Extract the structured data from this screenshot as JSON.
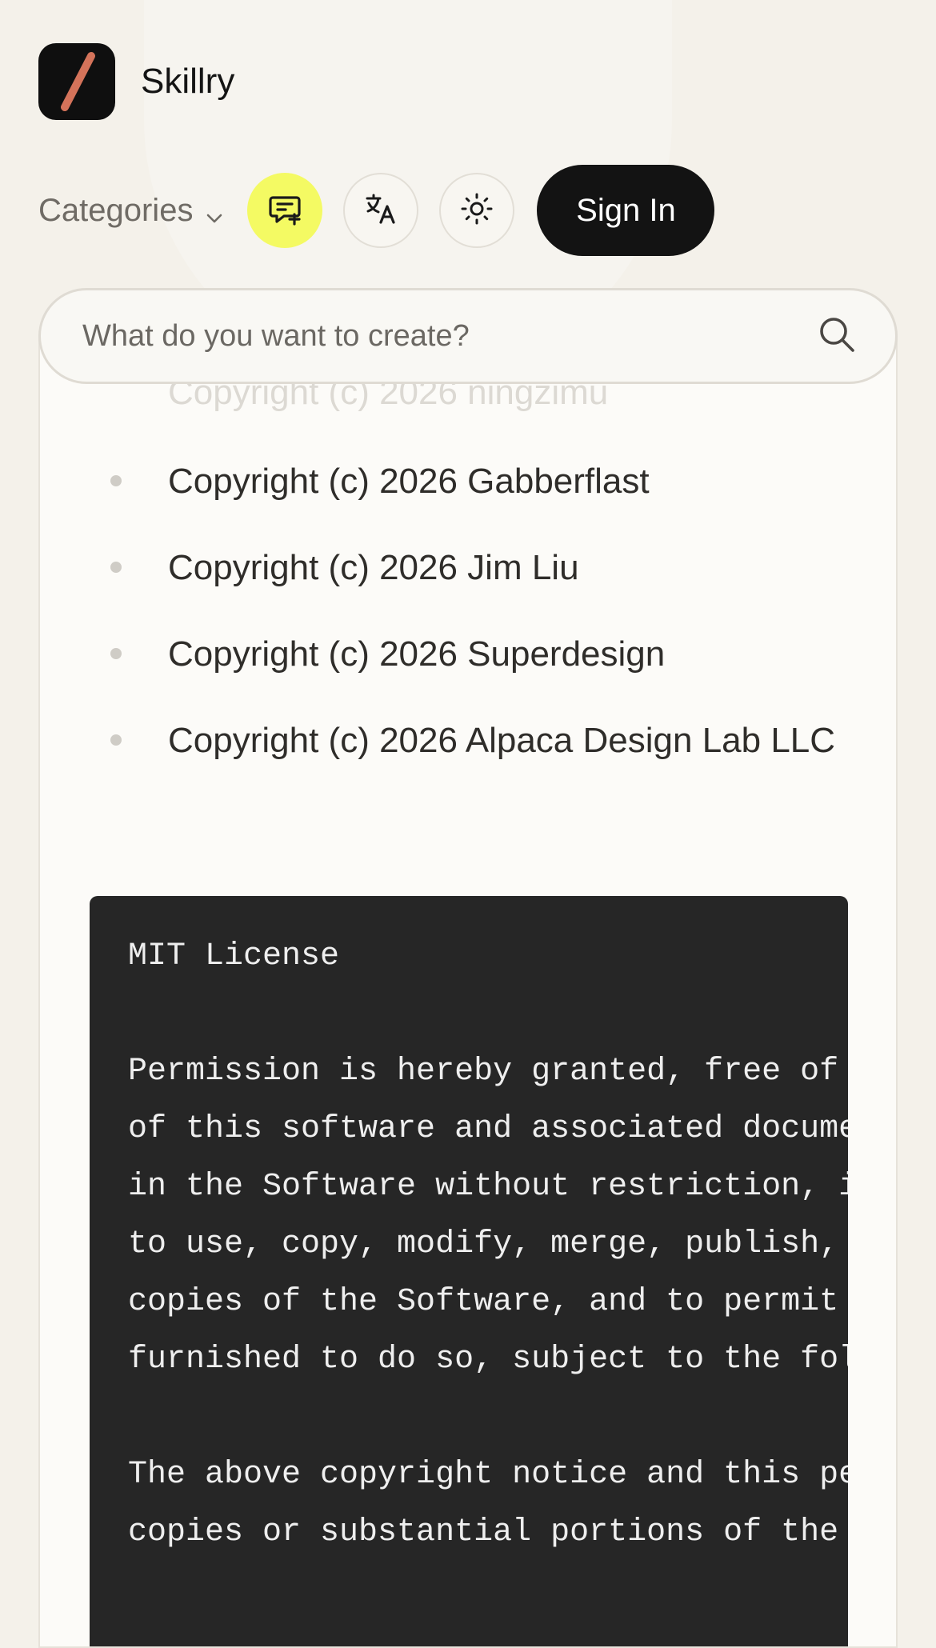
{
  "brand": {
    "name": "Skillry"
  },
  "nav": {
    "categories_label": "Categories",
    "sign_in_label": "Sign In"
  },
  "search": {
    "placeholder": "What do you want to create?"
  },
  "icons": {
    "logo": "slash-logo",
    "feedback": "message-plus-icon",
    "language": "translate-icon",
    "theme": "sun-icon",
    "search": "search-icon",
    "categories": "chevron-down-icon"
  },
  "colors": {
    "accent": "#f4fa63",
    "logo_stroke": "#d4735a",
    "dark": "#131313",
    "code_bg": "#262626"
  },
  "content": {
    "faded_copyright": "Copyright (c) 2026 ningzimu",
    "copyrights": [
      "Copyright (c) 2026 Gabberflast",
      "Copyright (c) 2026 Jim Liu",
      "Copyright (c) 2026 Superdesign",
      "Copyright (c) 2026 Alpaca Design Lab LLC"
    ],
    "license_lines": [
      "MIT License",
      "",
      "Permission is hereby granted, free of charge, to any person obtaining a copy",
      "of this software and associated documentation files (the \"Software\"), to deal",
      "in the Software without restriction, including without limitation the rights",
      "to use, copy, modify, merge, publish, distribute, sublicense, and/or sell",
      "copies of the Software, and to permit persons to whom the Software is",
      "furnished to do so, subject to the following conditions:",
      "",
      "The above copyright notice and this permission notice shall be included in all",
      "copies or substantial portions of the Software."
    ]
  }
}
